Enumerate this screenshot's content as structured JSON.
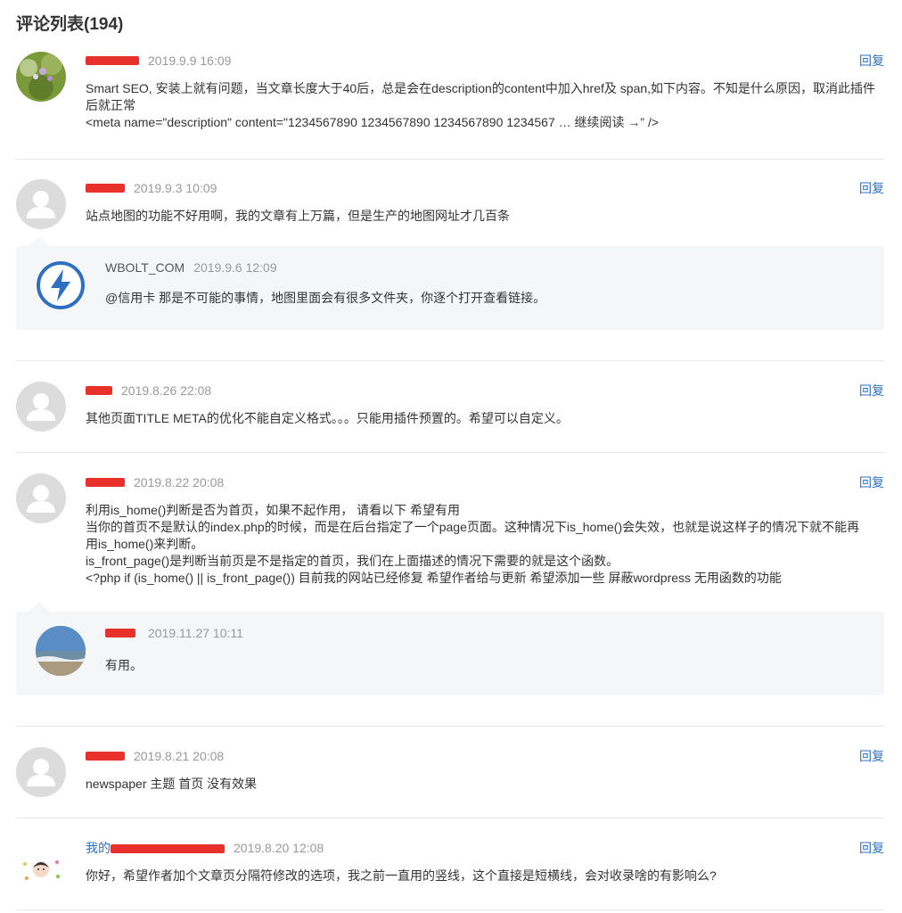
{
  "header": {
    "title": "评论列表(194)"
  },
  "reply_label": "回复",
  "comments": [
    {
      "author": "",
      "time": "2019.9.9 16:09",
      "lines": [
        "Smart SEO, 安装上就有问题，当文章长度大于40后，总是会在description的content中加入href及 span,如下内容。不知是什么原因，取消此插件后就正常",
        "<meta name=\"description\" content=\"1234567890 1234567890 1234567890 1234567 … 继续阅读 →”  />"
      ]
    },
    {
      "author": "",
      "time": "2019.9.3 10:09",
      "lines": [
        "站点地图的功能不好用啊，我的文章有上万篇，但是生产的地图网址才几百条"
      ],
      "reply": {
        "author": "WBOLT_COM",
        "time": "2019.9.6 12:09",
        "text": "@信用卡 那是不可能的事情，地图里面会有很多文件夹，你逐个打开查看链接。"
      }
    },
    {
      "author": "",
      "time": "2019.8.26 22:08",
      "lines": [
        "其他页面TITLE META的优化不能自定义格式。。。只能用插件预置的。希望可以自定义。"
      ]
    },
    {
      "author": "",
      "time": "2019.8.22 20:08",
      "lines": [
        "利用is_home()判断是否为首页，如果不起作用， 请看以下 希望有用",
        "当你的首页不是默认的index.php的时候，而是在后台指定了一个page页面。这种情况下is_home()会失效，也就是说这样子的情况下就不能再用is_home()来判断。",
        "is_front_page()是判断当前页是不是指定的首页，我们在上面描述的情况下需要的就是这个函数。",
        "<?php if (is_home() || is_front_page()) 目前我的网站已经修复 希望作者给与更新 希望添加一些 屏蔽wordpress 无用函数的功能"
      ],
      "reply": {
        "author": "",
        "time": "2019.11.27 10:11",
        "text": "有用。"
      }
    },
    {
      "author": "",
      "time": "2019.8.21 20:08",
      "lines": [
        "newspaper 主题 首页 没有效果"
      ]
    },
    {
      "author": "我的",
      "time": "2019.8.20 12:08",
      "lines": [
        "你好，希望作者加个文章页分隔符修改的选项，我之前一直用的竖线，这个直接是短横线，会对收录啥的有影响么?"
      ]
    }
  ],
  "colors": {
    "accent": "#2f6fc2",
    "redaction": "#e8312b",
    "brand_icon": "#2f6fc2"
  }
}
